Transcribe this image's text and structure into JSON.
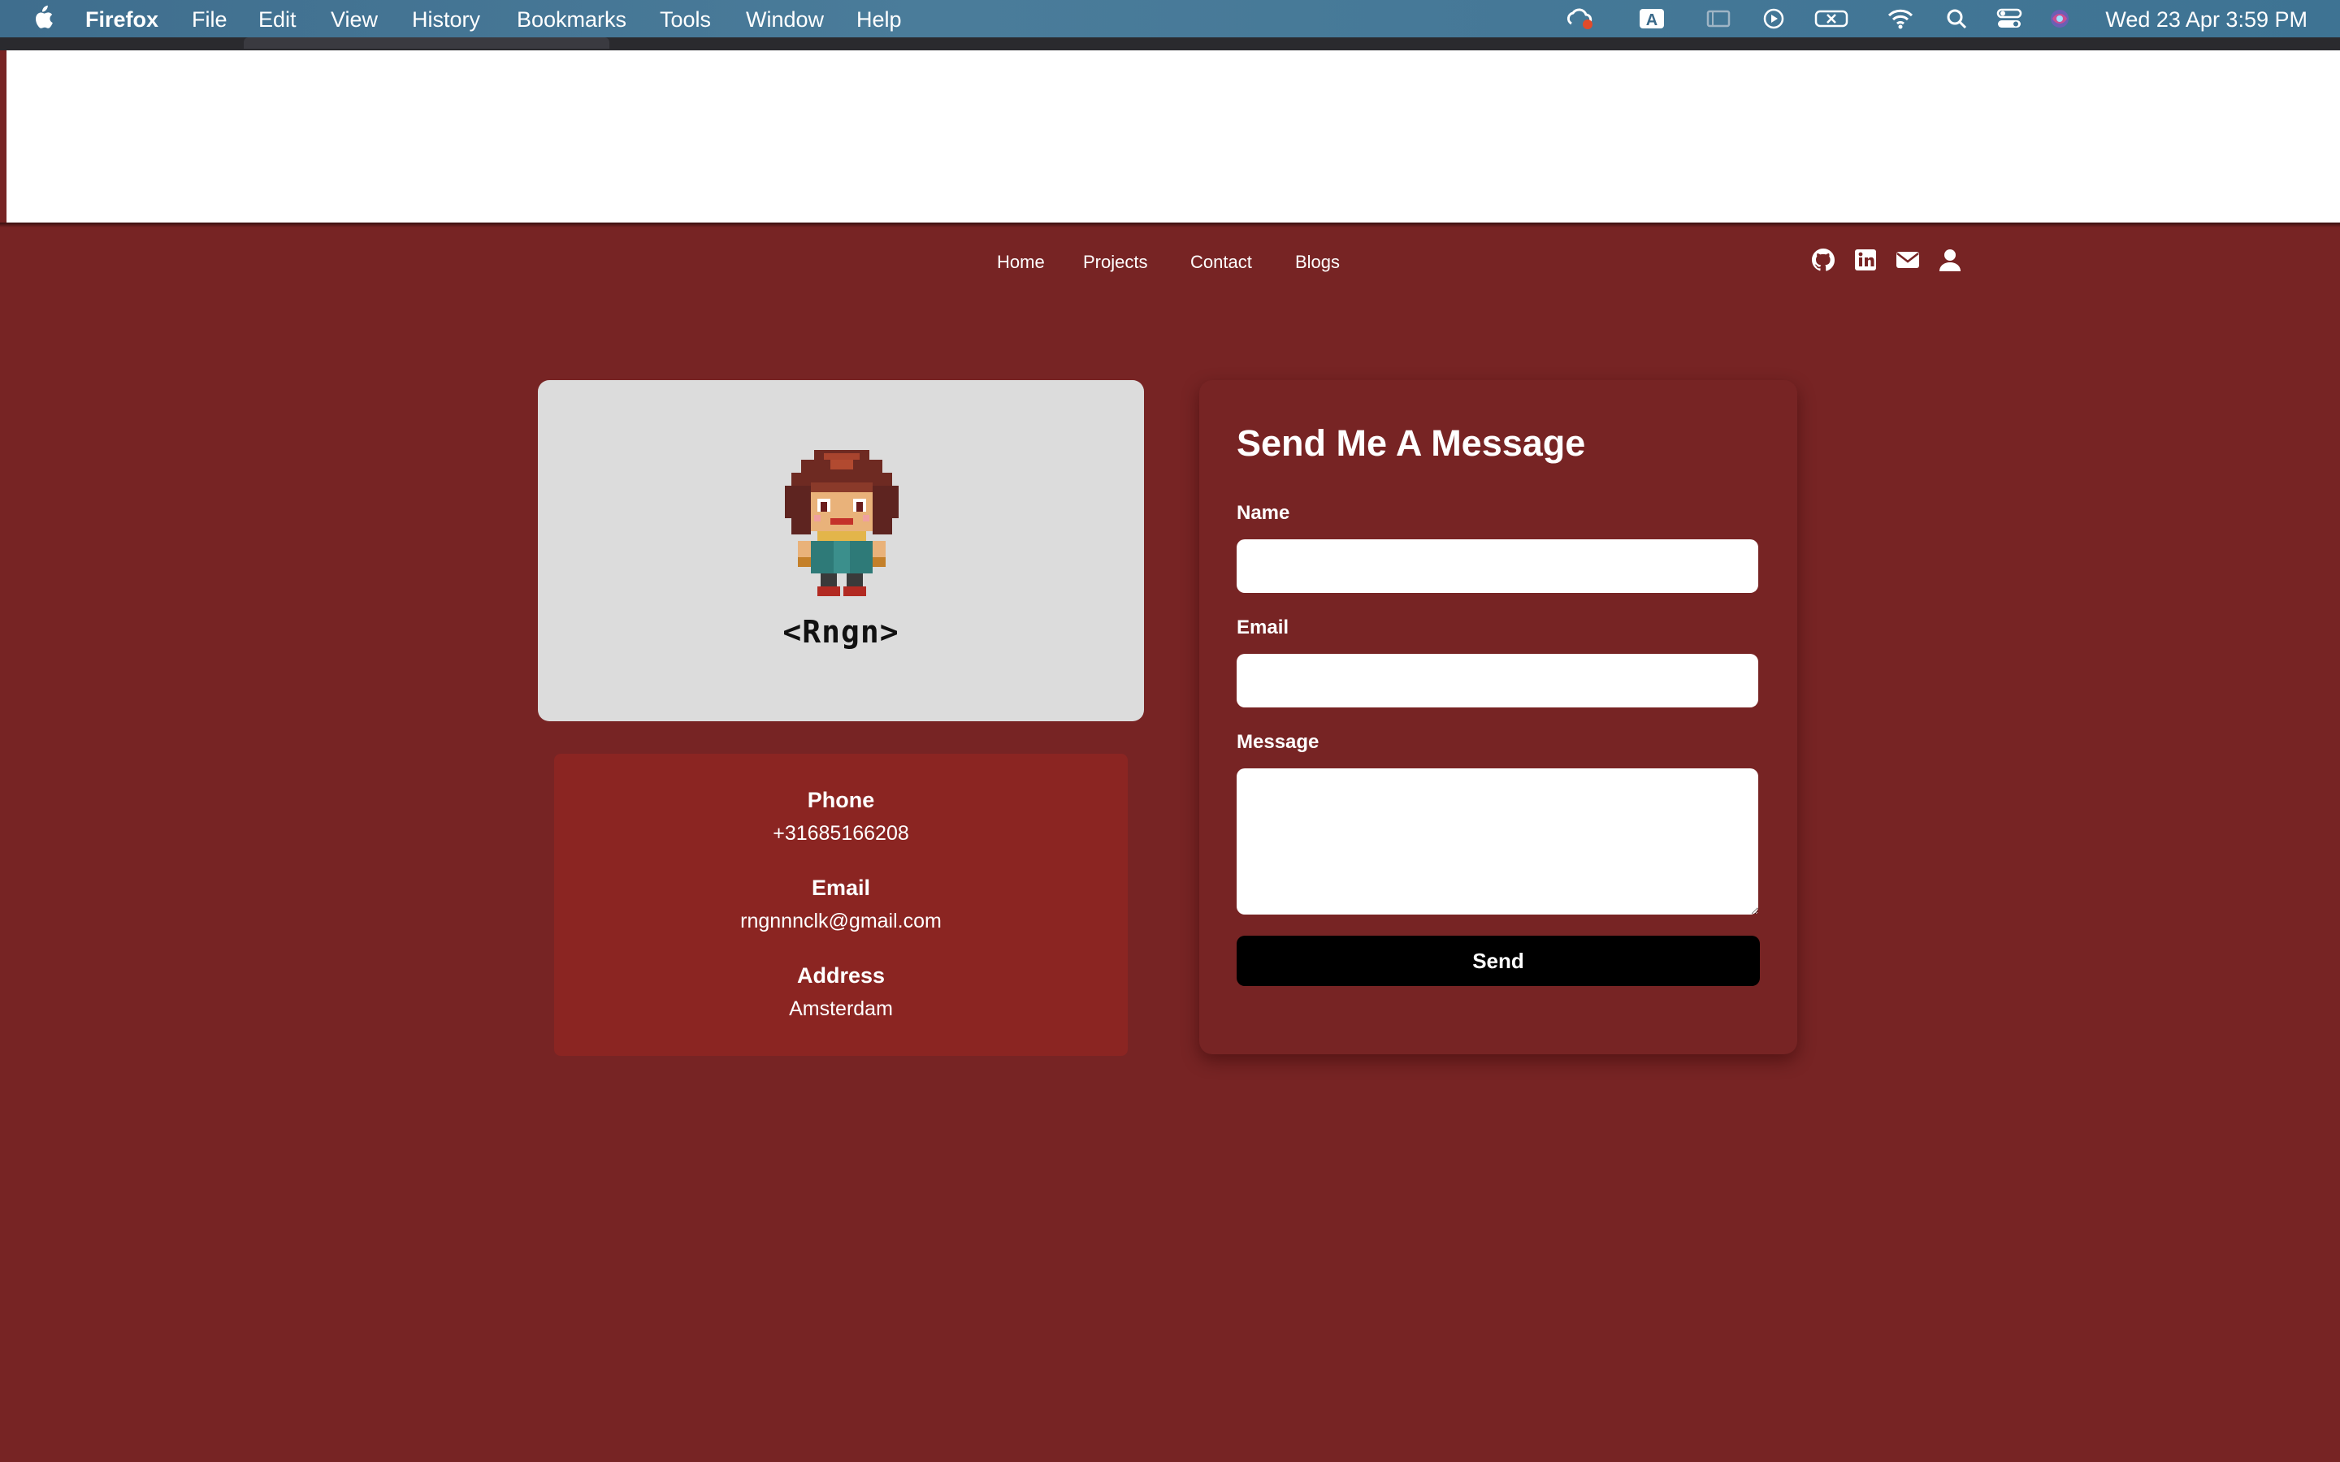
{
  "menubar": {
    "app_name": "Firefox",
    "items": [
      "File",
      "Edit",
      "View",
      "History",
      "Bookmarks",
      "Tools",
      "Window",
      "Help"
    ],
    "clock": "Wed 23 Apr  3:59 PM",
    "status_icons": [
      "creative-cloud-icon",
      "text-input-a-icon",
      "screen-mirror-icon",
      "play-circle-icon",
      "x-box-icon",
      "wifi-icon",
      "search-icon",
      "control-center-icon",
      "siri-icon"
    ]
  },
  "nav": {
    "links": [
      "Home",
      "Projects",
      "Contact",
      "Blogs"
    ],
    "social_icons": [
      "github-icon",
      "linkedin-icon",
      "mail-icon",
      "user-icon"
    ]
  },
  "profile": {
    "name": "<Rngn>",
    "avatar": "pixel-character-avatar"
  },
  "contact_info": {
    "phone_label": "Phone",
    "phone": "+31685166208",
    "email_label": "Email",
    "email": "rngnnnclk@gmail.com",
    "address_label": "Address",
    "address": "Amsterdam"
  },
  "form": {
    "title": "Send Me A Message",
    "name_label": "Name",
    "name_value": "",
    "email_label": "Email",
    "email_value": "",
    "message_label": "Message",
    "message_value": "",
    "send_label": "Send"
  },
  "colors": {
    "page_background": "#772424",
    "profile_card": "#dcdcdc",
    "info_card": "#8b2522",
    "send_button": "#000000"
  }
}
